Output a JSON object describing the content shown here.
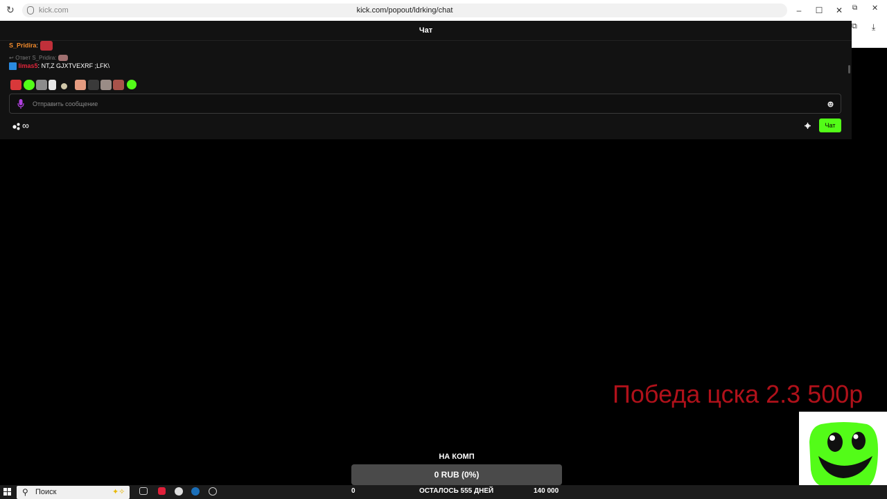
{
  "browser": {
    "host_label": "kick.com",
    "url": "kick.com/popout/ldrking/chat",
    "minimize": "–",
    "maximize": "☐",
    "close": "✕"
  },
  "chat": {
    "title": "Чат",
    "messages": [
      {
        "user": "S_Pridira",
        "sep": ":"
      },
      {
        "reply_label": "Ответ S_Pridira:"
      },
      {
        "user": "limas5",
        "sep": ":",
        "text": " NT,Z GJXTVEXRF ;LFK\\"
      }
    ],
    "input_placeholder": "Отправить сообщение",
    "infinity": "∞",
    "send_label": "Чат"
  },
  "overlay": {
    "bet_text": "Победа цска 2.3 500р"
  },
  "goal": {
    "title": "НА КОМП",
    "progress_text": "0 RUB (0%)",
    "progress": 0,
    "start": "0",
    "remaining": "ОСТАЛОСЬ 555 ДНЕЙ",
    "target": "140 000"
  },
  "taskbar": {
    "search_label": "Поиск"
  },
  "colors": {
    "kick_green": "#53fc18",
    "bet_red": "#b0111a"
  }
}
